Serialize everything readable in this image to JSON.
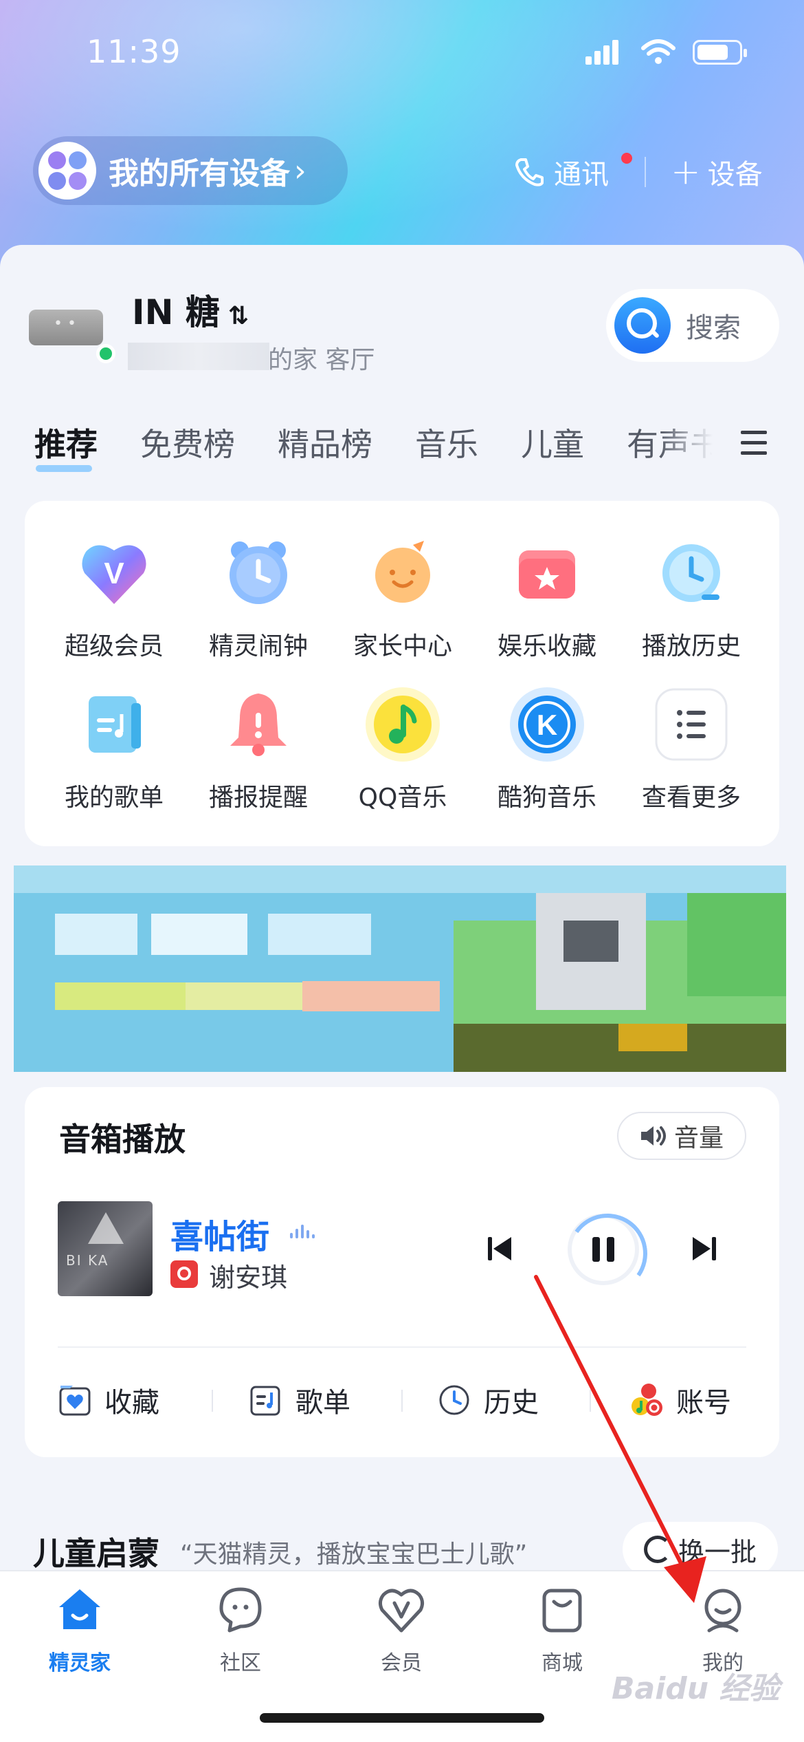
{
  "status_bar": {
    "time": "11:39"
  },
  "header": {
    "devices_label": "我的所有设备",
    "messages_label": "通讯",
    "add_device_label": "设备"
  },
  "device": {
    "name": "IN 糖",
    "location": "的家 客厅",
    "search_label": "搜索"
  },
  "tabs": [
    "推荐",
    "免费榜",
    "精品榜",
    "音乐",
    "儿童",
    "有声书"
  ],
  "shortcuts": [
    {
      "label": "超级会员",
      "icon": "super-vip-icon"
    },
    {
      "label": "精灵闹钟",
      "icon": "alarm-clock-icon"
    },
    {
      "label": "家长中心",
      "icon": "parent-center-icon"
    },
    {
      "label": "娱乐收藏",
      "icon": "favorites-folder-icon"
    },
    {
      "label": "播放历史",
      "icon": "play-history-icon"
    },
    {
      "label": "我的歌单",
      "icon": "my-playlist-icon"
    },
    {
      "label": "播报提醒",
      "icon": "reminder-bell-icon"
    },
    {
      "label": "QQ音乐",
      "icon": "qq-music-icon"
    },
    {
      "label": "酷狗音乐",
      "icon": "kugou-music-icon"
    },
    {
      "label": "查看更多",
      "icon": "more-list-icon"
    }
  ],
  "player": {
    "title": "音箱播放",
    "volume_label": "音量",
    "song": "喜帖街",
    "artist": "谢安琪",
    "actions": [
      {
        "label": "收藏",
        "icon": "favorite-icon"
      },
      {
        "label": "歌单",
        "icon": "playlist-icon"
      },
      {
        "label": "历史",
        "icon": "history-clock-icon"
      },
      {
        "label": "账号",
        "icon": "account-icon"
      }
    ]
  },
  "kids": {
    "title": "儿童启蒙",
    "subtitle": "“天猫精灵，播放宝宝巴士儿歌”",
    "refresh_label": "换一批"
  },
  "bottom_nav": [
    {
      "label": "精灵家",
      "icon": "home-icon",
      "active": true
    },
    {
      "label": "社区",
      "icon": "community-icon",
      "active": false
    },
    {
      "label": "会员",
      "icon": "vip-icon",
      "active": false
    },
    {
      "label": "商城",
      "icon": "shop-bag-icon",
      "active": false
    },
    {
      "label": "我的",
      "icon": "profile-icon",
      "active": false
    }
  ],
  "watermark": "Baidu 经验",
  "colors": {
    "accent": "#1a7ef0",
    "annotation_arrow": "#e8231f"
  }
}
